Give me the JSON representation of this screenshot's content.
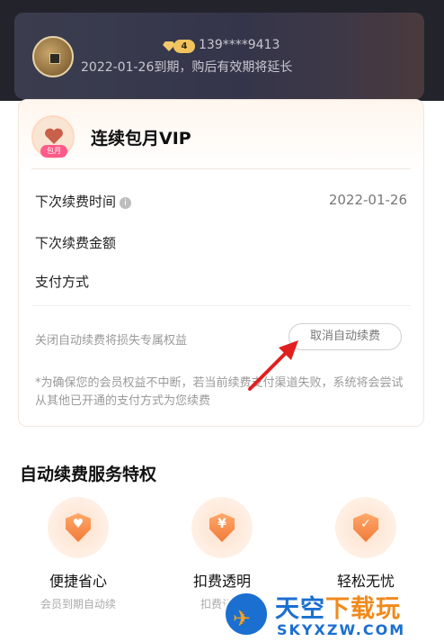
{
  "member": {
    "vip_level": "4",
    "phone": "139****9413",
    "expiry_text": "2022-01-26到期，购后有效期将延长"
  },
  "package": {
    "tag": "包月",
    "name": "连续包月VIP"
  },
  "details": {
    "next_renew_time_label": "下次续费时间",
    "next_renew_time_value": "2022-01-26",
    "next_renew_amount_label": "下次续费金额",
    "payment_method_label": "支付方式",
    "warning_text": "关闭自动续费将损失专属权益",
    "cancel_button": "取消自动续费",
    "note": "*为确保您的会员权益不中断，若当前续费支付渠道失败，系统将会尝试从其他已开通的支付方式为您续费"
  },
  "section": {
    "title": "自动续费服务特权"
  },
  "perks": [
    {
      "icon": "heart-shield-icon",
      "title": "便捷省心",
      "subtitle": "会员到期自动续"
    },
    {
      "icon": "yen-shield-icon",
      "title": "扣费透明",
      "subtitle": "扣费记录"
    },
    {
      "icon": "check-shield-icon",
      "title": "轻松无忧",
      "subtitle": ""
    }
  ],
  "watermark": {
    "main_a": "天空",
    "main_b": "下载玩",
    "url": "SKYXZW.COM"
  },
  "colors": {
    "accent_orange": "#f07b3a",
    "dark_header": "#23232c",
    "annotation_red": "#e02020"
  }
}
